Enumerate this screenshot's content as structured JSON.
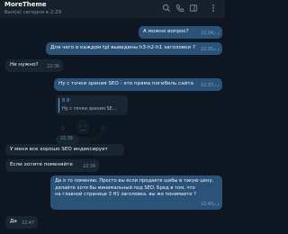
{
  "header": {
    "title": "MoreTheme",
    "status": "был(а) сегодня в 2:29",
    "icons": [
      "search-icon",
      "phone-icon",
      "sidebar-icon",
      "more-icon"
    ]
  },
  "messages": [
    {
      "id": "m1",
      "side": "out",
      "text": "А можно вопрос?",
      "time": "22:34"
    },
    {
      "id": "m2",
      "side": "out",
      "text": "Для чего в каждом tpl выведены h3-h2-h1 заголовки ?",
      "time": "22:35"
    },
    {
      "id": "m3",
      "side": "in",
      "text": "Не нужно?",
      "time": "22:36"
    },
    {
      "id": "m4",
      "side": "out",
      "text": "Ну с точки зрения SEO - это пряма погибель сайта",
      "time": "22:37"
    },
    {
      "id": "m5",
      "side": "in",
      "reply_name": "В В",
      "reply_text": "Ну с точки зрения SE...",
      "time": "22:39",
      "sticker": "shrug-sticker"
    },
    {
      "id": "m6",
      "side": "in",
      "text": "У меня все хорошо SEO индексирует",
      "time": ""
    },
    {
      "id": "m7",
      "side": "in",
      "text": "Если хотите поменяйте",
      "time": "22:39"
    },
    {
      "id": "m8",
      "side": "out",
      "lines": [
        "Да я то поменяю. Просто вы если продаете шабы в такую цену,",
        "делайте хотя бы минимальный под SEO. Бред в том, что",
        "на главной странице 3 H1 заголовка. вы же понимаете ?"
      ],
      "time": "22:40"
    },
    {
      "id": "m9",
      "side": "in",
      "text": "Да",
      "time": "22:47"
    }
  ],
  "colors": {
    "background": "#0e1621",
    "header": "#17212b",
    "outgoing": "#2b5278",
    "incoming": "#182533",
    "accent": "#5da3e0"
  }
}
